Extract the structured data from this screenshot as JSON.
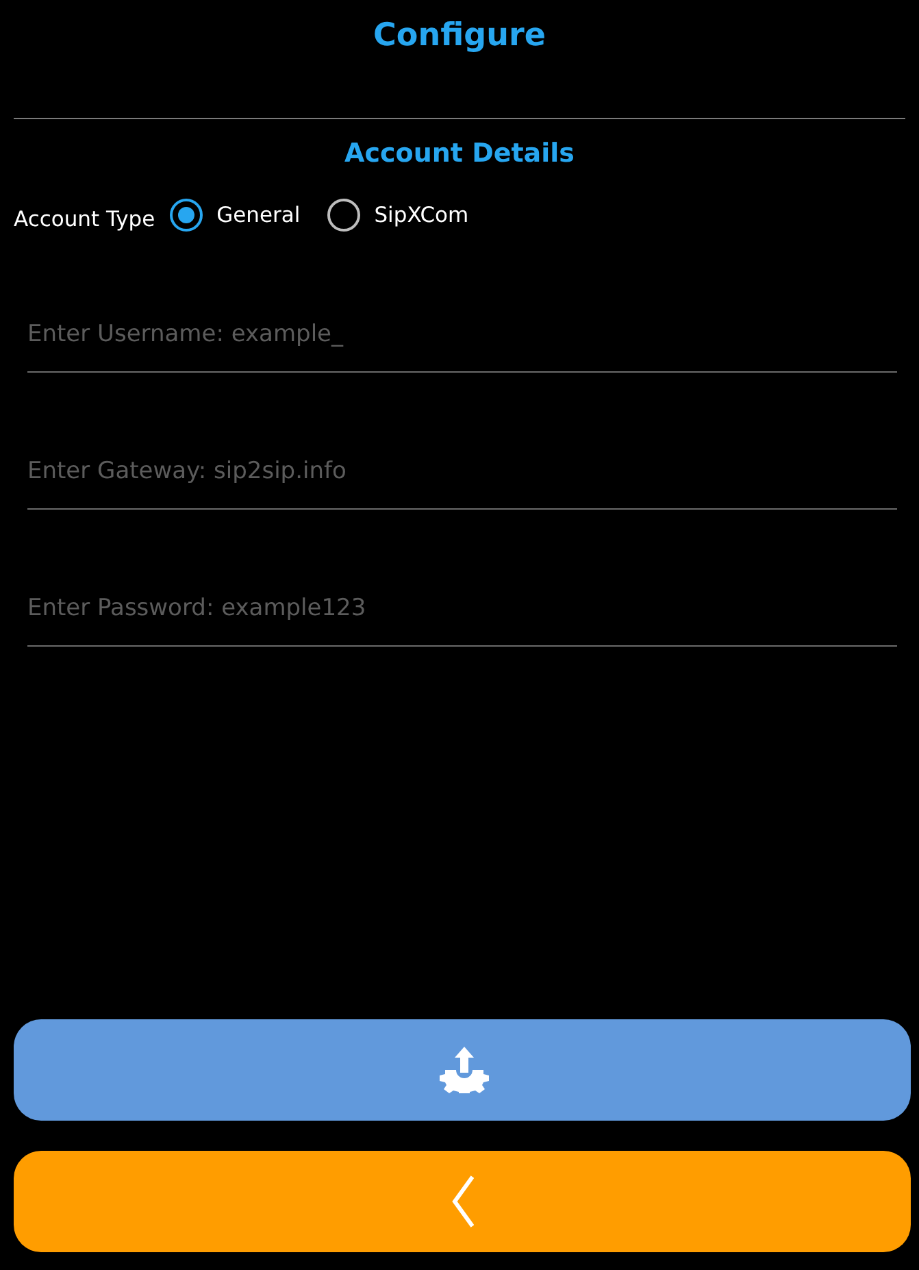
{
  "header": {
    "title": "Configure"
  },
  "section": {
    "title": "Account Details"
  },
  "account_type": {
    "label": "Account Type",
    "options": [
      {
        "label": "General",
        "selected": true
      },
      {
        "label": "SipXCom",
        "selected": false
      }
    ]
  },
  "fields": [
    {
      "placeholder": "Enter Username: example_"
    },
    {
      "placeholder": "Enter Gateway: sip2sip.info"
    },
    {
      "placeholder": "Enter Password: example123"
    }
  ],
  "buttons": [
    {
      "kind": "upload"
    },
    {
      "kind": "back"
    }
  ]
}
